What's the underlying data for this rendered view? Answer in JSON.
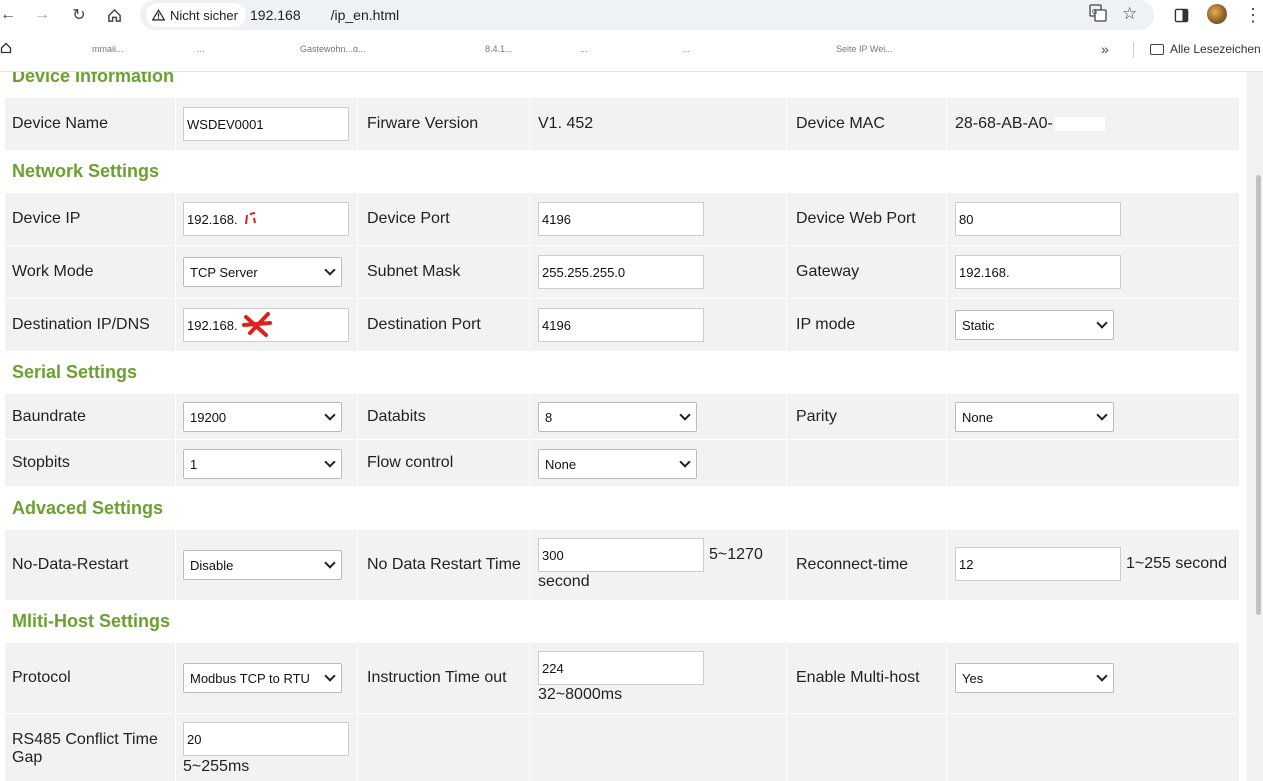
{
  "browser": {
    "security_label": "Nicht sicher",
    "url_start": "192.168",
    "url_end": "/ip_en.html",
    "bookmarks": [
      "mmaii...",
      "...",
      "Gastewohn...g...",
      "8.4.1...",
      "...",
      "...",
      "Seite IP Wei..."
    ],
    "all_bookmarks": "Alle Lesezeichen"
  },
  "sections": {
    "device_info": "Device Information",
    "network": "Network Settings",
    "serial": "Serial Settings",
    "advanced": "Advaced Settings",
    "multihost": "Mliti-Host Settings"
  },
  "device": {
    "name_label": "Device Name",
    "name_value": "WSDEV0001",
    "fw_label": "Firware Version",
    "fw_value": "V1. 452",
    "mac_label": "Device MAC",
    "mac_value": "28-68-AB-A0-"
  },
  "network": {
    "ip_label": "Device IP",
    "ip_value": "192.168.",
    "port_label": "Device Port",
    "port_value": "4196",
    "webport_label": "Device Web Port",
    "webport_value": "80",
    "workmode_label": "Work Mode",
    "workmode_value": "TCP Server",
    "mask_label": "Subnet Mask",
    "mask_value": "255.255.255.0",
    "gateway_label": "Gateway",
    "gateway_value": "192.168.",
    "dest_label": "Destination IP/DNS",
    "dest_value": "192.168.",
    "destport_label": "Destination Port",
    "destport_value": "4196",
    "ipmode_label": "IP mode",
    "ipmode_value": "Static"
  },
  "serial": {
    "baud_label": "Baundrate",
    "baud_value": "19200",
    "databits_label": "Databits",
    "databits_value": "8",
    "parity_label": "Parity",
    "parity_value": "None",
    "stopbits_label": "Stopbits",
    "stopbits_value": "1",
    "flow_label": "Flow control",
    "flow_value": "None"
  },
  "advanced": {
    "nodata_label": "No-Data-Restart",
    "nodata_value": "Disable",
    "nodatatime_label": "No Data Restart Time",
    "nodatatime_value": "300",
    "nodatatime_range": "5~1270",
    "nodatatime_unit": "second",
    "reconnect_label": "Reconnect-time",
    "reconnect_value": "12",
    "reconnect_range": "1~255 second"
  },
  "multihost": {
    "protocol_label": "Protocol",
    "protocol_value": "Modbus TCP to RTU",
    "timeout_label": "Instruction Time out",
    "timeout_value": "224",
    "timeout_range": "32~8000ms",
    "enable_label": "Enable Multi-host",
    "enable_value": "Yes",
    "rs485_label_1": "RS485 Conflict Time",
    "rs485_label_2": "Gap",
    "rs485_value": "20",
    "rs485_range": "5~255ms"
  },
  "colors": {
    "section_title": "#6aa12f",
    "row_background": "#f2f2f2",
    "redaction_mark": "#e02020"
  }
}
